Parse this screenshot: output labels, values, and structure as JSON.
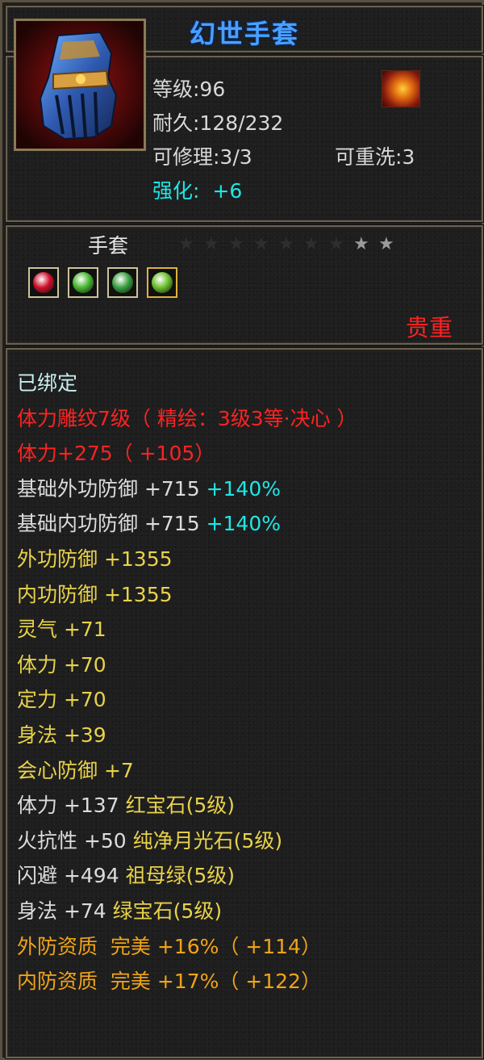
{
  "item": {
    "name": "幻世手套",
    "level": "等级:96",
    "durability": "耐久:128/232",
    "repairable": "可修理:3/3",
    "rewashable": "可重洗:3",
    "enhance_label": "强化:",
    "enhance_value": "+6",
    "type": "手套",
    "quality": "贵重",
    "stars_total": 9,
    "stars_lit": 2
  },
  "gems": [
    {
      "name": "ruby-gem",
      "color": "#d0102a"
    },
    {
      "name": "green-gem",
      "color": "#48b830"
    },
    {
      "name": "green-gem",
      "color": "#3aa040"
    },
    {
      "name": "emerald-gem",
      "color": "#6ac02a"
    }
  ],
  "attributes": [
    {
      "parts": [
        {
          "text": "已绑定",
          "color": "bound"
        }
      ]
    },
    {
      "parts": [
        {
          "text": "体力雕纹7级（ 精绘：3级3等·决心 ）",
          "color": "red"
        }
      ]
    },
    {
      "parts": [
        {
          "text": "体力+275（ +105）",
          "color": "red"
        }
      ]
    },
    {
      "parts": [
        {
          "text": "基础外功防御 +715 ",
          "color": "white"
        },
        {
          "text": "+140%",
          "color": "cyan"
        }
      ]
    },
    {
      "parts": [
        {
          "text": "基础内功防御 +715 ",
          "color": "white"
        },
        {
          "text": "+140%",
          "color": "cyan"
        }
      ]
    },
    {
      "parts": [
        {
          "text": "外功防御 +1355",
          "color": "yellow"
        }
      ]
    },
    {
      "parts": [
        {
          "text": "内功防御 +1355",
          "color": "yellow"
        }
      ]
    },
    {
      "parts": [
        {
          "text": "灵气 +71",
          "color": "yellow"
        }
      ]
    },
    {
      "parts": [
        {
          "text": "体力 +70",
          "color": "yellow"
        }
      ]
    },
    {
      "parts": [
        {
          "text": "定力 +70",
          "color": "yellow"
        }
      ]
    },
    {
      "parts": [
        {
          "text": "身法 +39",
          "color": "yellow"
        }
      ]
    },
    {
      "parts": [
        {
          "text": "会心防御 +7",
          "color": "yellow"
        }
      ]
    },
    {
      "parts": [
        {
          "text": "体力 +137 ",
          "color": "white"
        },
        {
          "text": "红宝石(5级)",
          "color": "yellow"
        }
      ]
    },
    {
      "parts": [
        {
          "text": "火抗性 +50 ",
          "color": "white"
        },
        {
          "text": "纯净月光石(5级)",
          "color": "yellow"
        }
      ]
    },
    {
      "parts": [
        {
          "text": "闪避 +494 ",
          "color": "white"
        },
        {
          "text": "祖母绿(5级)",
          "color": "yellow"
        }
      ]
    },
    {
      "parts": [
        {
          "text": "身法 +74 ",
          "color": "white"
        },
        {
          "text": "绿宝石(5级)",
          "color": "yellow"
        }
      ]
    },
    {
      "parts": [
        {
          "text": "外防资质  完美 +16%（ +114）",
          "color": "orange"
        }
      ]
    },
    {
      "parts": [
        {
          "text": "内防资质  完美 +17%（ +122）",
          "color": "orange"
        }
      ]
    }
  ]
}
